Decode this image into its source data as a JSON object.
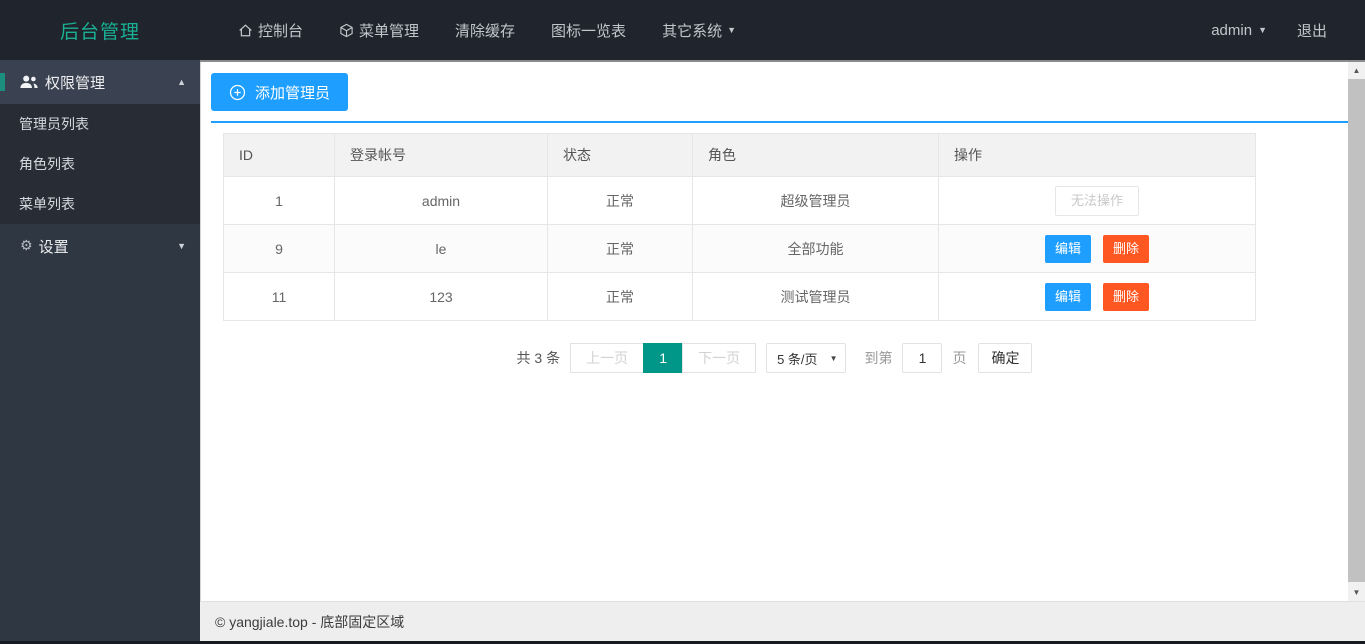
{
  "brand": "后台管理",
  "navbar": {
    "items": [
      {
        "label": "控制台",
        "icon": "home-icon"
      },
      {
        "label": "菜单管理",
        "icon": "cube-icon"
      },
      {
        "label": "清除缓存"
      },
      {
        "label": "图标一览表"
      },
      {
        "label": "其它系统",
        "has_caret": true
      }
    ],
    "user": "admin",
    "logout": "退出"
  },
  "sidebar": {
    "groups": [
      {
        "label": "权限管理",
        "icon": "users-icon",
        "expanded": true,
        "items": [
          "管理员列表",
          "角色列表",
          "菜单列表"
        ]
      },
      {
        "label": "设置",
        "icon": "gear-icon",
        "expanded": false,
        "items": []
      }
    ]
  },
  "toolbar": {
    "add_button": "添加管理员"
  },
  "table": {
    "headers": [
      "ID",
      "登录帐号",
      "状态",
      "角色",
      "操作"
    ],
    "rows": [
      {
        "id": "1",
        "account": "admin",
        "status": "正常",
        "role": "超级管理员",
        "actions": [
          {
            "label": "无法操作",
            "type": "disabled"
          }
        ]
      },
      {
        "id": "9",
        "account": "le",
        "status": "正常",
        "role": "全部功能",
        "actions": [
          {
            "label": "编辑",
            "type": "edit"
          },
          {
            "label": "删除",
            "type": "delete"
          }
        ]
      },
      {
        "id": "11",
        "account": "123",
        "status": "正常",
        "role": "测试管理员",
        "actions": [
          {
            "label": "编辑",
            "type": "edit"
          },
          {
            "label": "删除",
            "type": "delete"
          }
        ]
      }
    ]
  },
  "pagination": {
    "total": "共 3 条",
    "prev": "上一页",
    "page": "1",
    "next": "下一页",
    "page_size": "5 条/页",
    "goto_prefix": "到第",
    "goto_value": "1",
    "goto_suffix": "页",
    "confirm": "确定"
  },
  "footer": {
    "text": "© yangjiale.top - 底部固定区域"
  },
  "colors": {
    "accent_blue": "#1E9FFF",
    "danger_orange": "#FF5722",
    "active_teal": "#009688",
    "brand_teal": "#19b094",
    "navbar_bg": "#20242c",
    "sidebar_bg": "#2f3743",
    "submenu_bg": "#272c35"
  }
}
